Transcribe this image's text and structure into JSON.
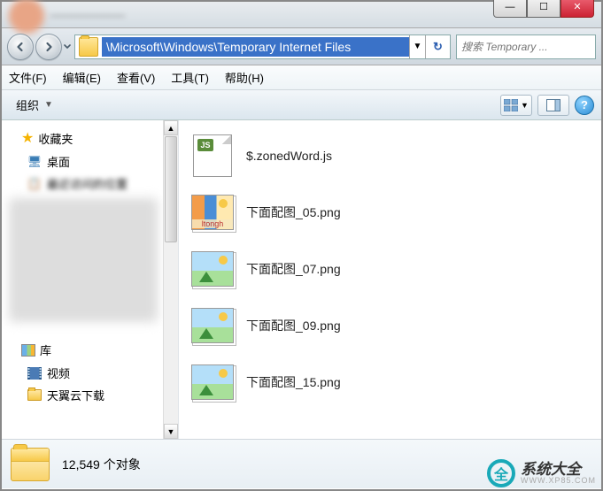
{
  "title_bar": {
    "blurred_title": "———————"
  },
  "window_controls": {
    "min": "—",
    "max": "☐",
    "close": "✕"
  },
  "nav": {
    "address_path": "\\Microsoft\\Windows\\Temporary Internet Files",
    "dropdown_glyph": "▼",
    "refresh_glyph": "↻",
    "search_placeholder": "搜索 Temporary ...",
    "search_icon": "🔍",
    "history_glyph": "▼"
  },
  "menu": {
    "file": "文件(F)",
    "edit": "编辑(E)",
    "view": "查看(V)",
    "tools": "工具(T)",
    "help": "帮助(H)"
  },
  "command_bar": {
    "organize": "组织",
    "organize_arrow": "▼",
    "view_hint": "▼",
    "help": "?"
  },
  "sidebar": {
    "favorites_header": "收藏夹",
    "favorites": [
      {
        "icon": "🖥",
        "label": "桌面"
      },
      {
        "icon": "📋",
        "label": "最近访问的位置"
      }
    ],
    "libraries_header": "库",
    "libraries": [
      {
        "icon": "film",
        "label": "视频"
      },
      {
        "icon": "folder",
        "label": "天翼云下载"
      }
    ]
  },
  "files": [
    {
      "type": "js",
      "name": "$.zonedWord.js",
      "badge": "JS"
    },
    {
      "type": "img-special",
      "name": "下面配图_05.png",
      "overlay": "ltongh"
    },
    {
      "type": "img",
      "name": "下面配图_07.png"
    },
    {
      "type": "img",
      "name": "下面配图_09.png"
    },
    {
      "type": "img",
      "name": "下面配图_15.png"
    }
  ],
  "status": {
    "count_text": "12,549 个对象"
  },
  "watermark": {
    "brand": "系统大全",
    "url": "WWW.XP85.COM",
    "logo_char": "全"
  }
}
